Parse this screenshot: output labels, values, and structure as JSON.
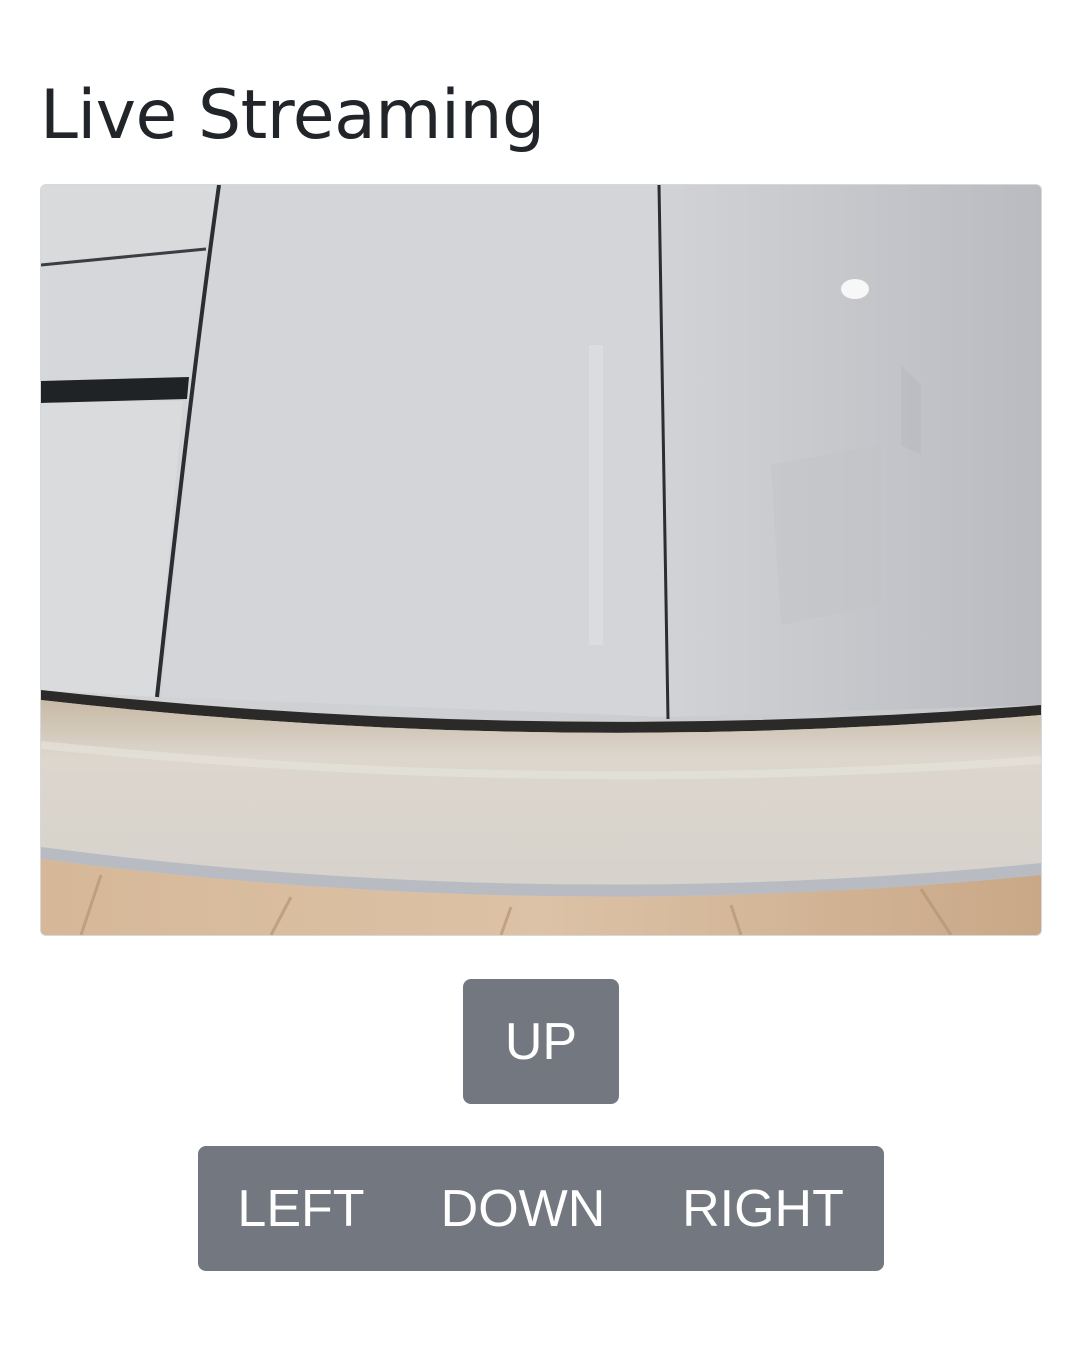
{
  "page": {
    "title": "Live Streaming"
  },
  "stream": {
    "content": "camera-feed-image"
  },
  "controls": {
    "up_label": "UP",
    "left_label": "LEFT",
    "down_label": "DOWN",
    "right_label": "RIGHT",
    "button_color": "#737880",
    "button_text_color": "#ffffff"
  }
}
